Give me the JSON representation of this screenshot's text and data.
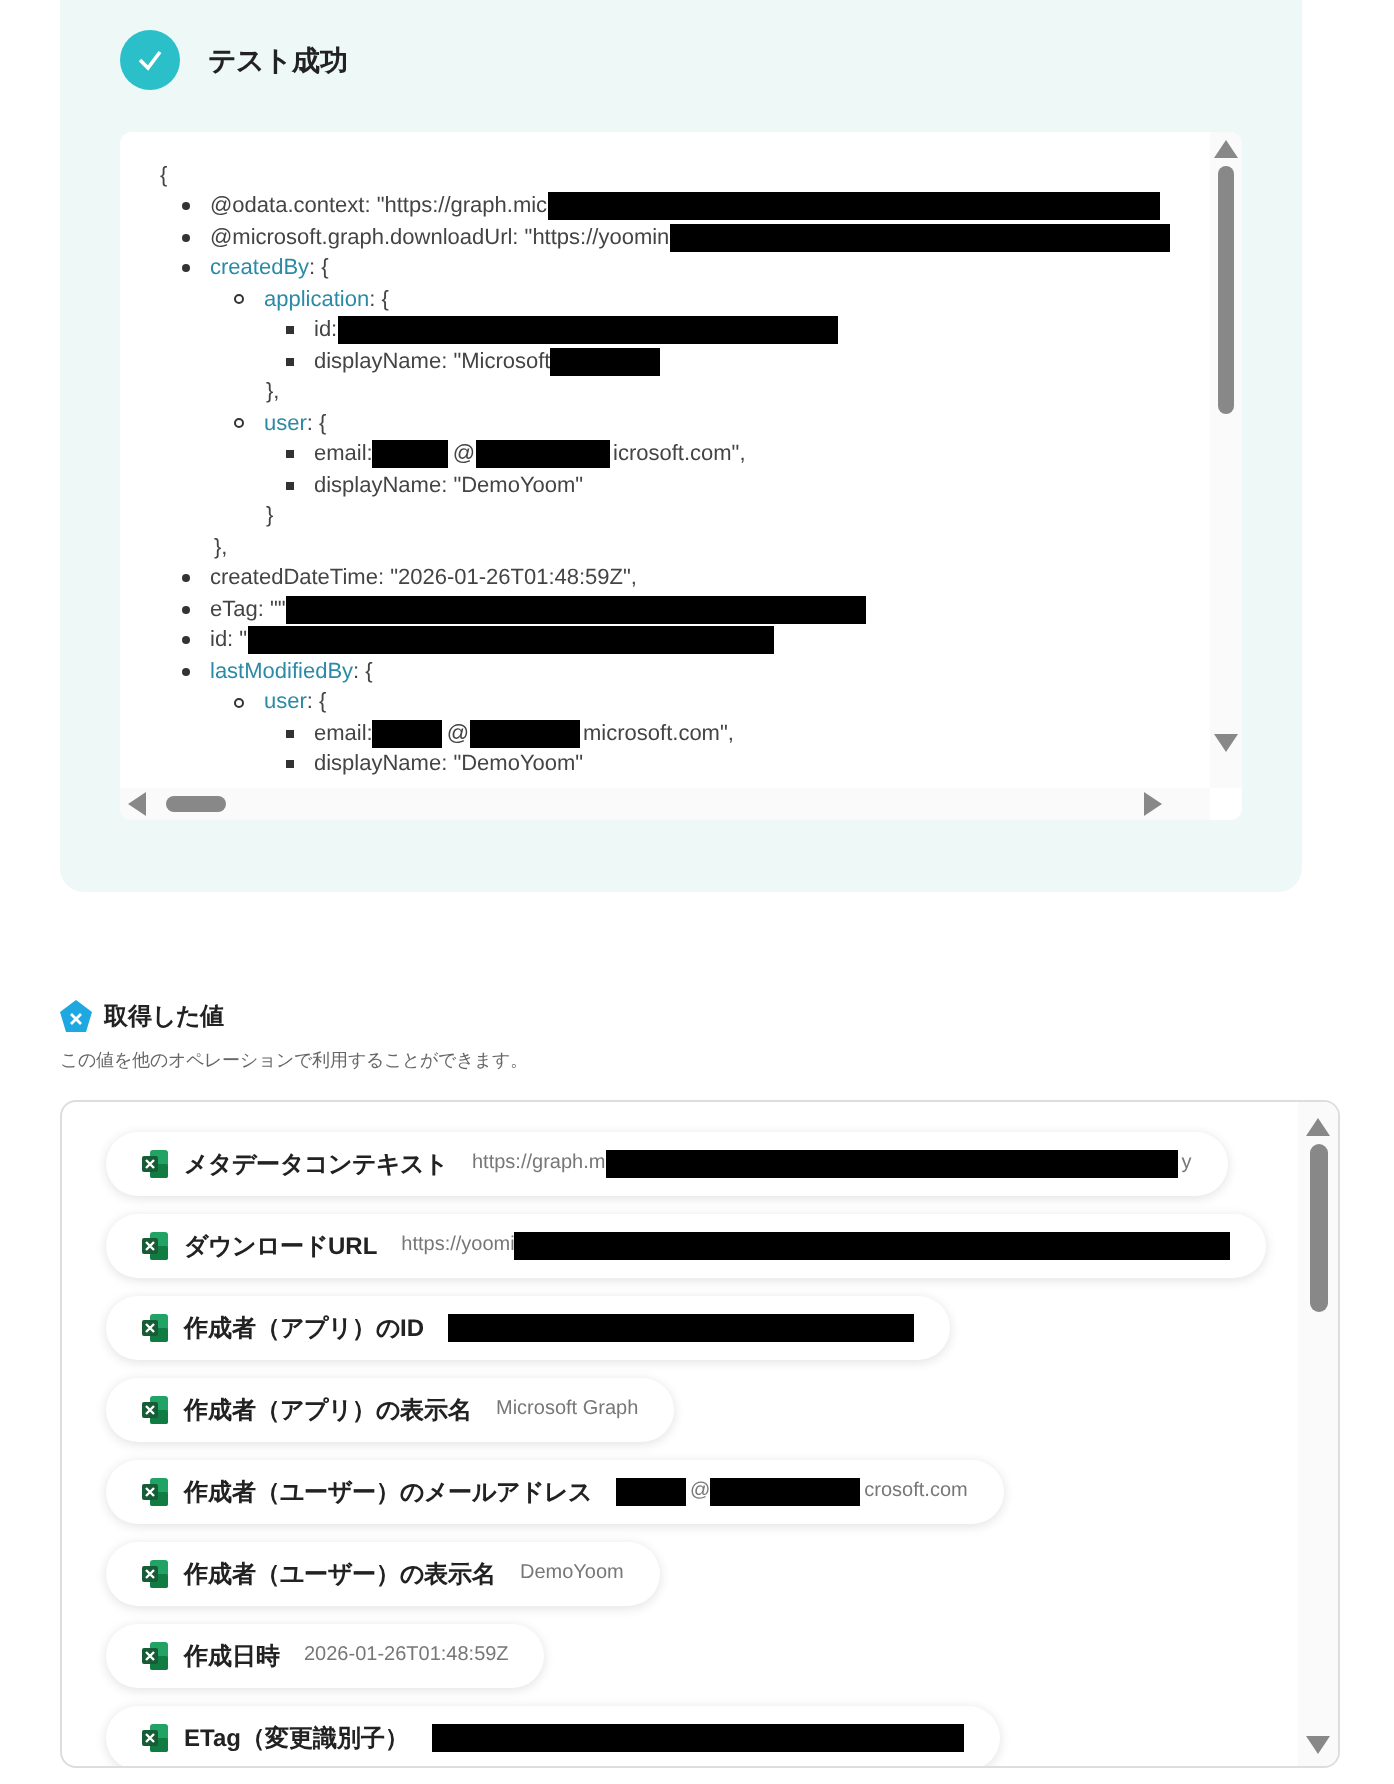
{
  "test_result": {
    "title": "テスト成功",
    "code_view": {
      "open": "{",
      "items": [
        {
          "kind": "value",
          "parts": [
            {
              "kind": "text",
              "text": "@odata.context: \"https://graph.mic"
            },
            {
              "kind": "redacted"
            }
          ]
        },
        {
          "kind": "value",
          "parts": [
            {
              "kind": "text",
              "text": "@microsoft.graph.downloadUrl: \"https://yoomin"
            },
            {
              "kind": "redacted"
            }
          ]
        },
        {
          "kind": "object",
          "key": "createdBy",
          "open": ": {",
          "close": "},",
          "children": [
            {
              "kind": "object",
              "key": "application",
              "open": ": {",
              "close": "},",
              "children": [
                {
                  "kind": "value",
                  "parts": [
                    {
                      "kind": "text",
                      "text": "id: "
                    },
                    {
                      "kind": "redacted"
                    }
                  ]
                },
                {
                  "kind": "value",
                  "parts": [
                    {
                      "kind": "text",
                      "text": "displayName: \"Microsoft"
                    },
                    {
                      "kind": "redacted"
                    }
                  ]
                }
              ]
            },
            {
              "kind": "object",
              "key": "user",
              "open": ": {",
              "close": "}",
              "children": [
                {
                  "kind": "value",
                  "parts": [
                    {
                      "kind": "text",
                      "text": "email:"
                    },
                    {
                      "kind": "redacted"
                    },
                    {
                      "kind": "text",
                      "text": "@"
                    },
                    {
                      "kind": "redacted"
                    },
                    {
                      "kind": "text",
                      "text": "icrosoft.com\","
                    }
                  ]
                },
                {
                  "kind": "value",
                  "parts": [
                    {
                      "kind": "text",
                      "text": "displayName: \"DemoYoom\""
                    }
                  ]
                }
              ]
            }
          ]
        },
        {
          "kind": "value",
          "parts": [
            {
              "kind": "text",
              "text": "createdDateTime: \"2026-01-26T01:48:59Z\","
            }
          ]
        },
        {
          "kind": "value",
          "parts": [
            {
              "kind": "text",
              "text": "eTag: \"\""
            },
            {
              "kind": "redacted"
            }
          ]
        },
        {
          "kind": "value",
          "parts": [
            {
              "kind": "text",
              "text": "id: \""
            },
            {
              "kind": "redacted"
            }
          ]
        },
        {
          "kind": "object",
          "key": "lastModifiedBy",
          "open": ": {",
          "children": [
            {
              "kind": "object",
              "key": "user",
              "open": ": {",
              "children": [
                {
                  "kind": "value",
                  "parts": [
                    {
                      "kind": "text",
                      "text": "email:"
                    },
                    {
                      "kind": "redacted"
                    },
                    {
                      "kind": "text",
                      "text": "@"
                    },
                    {
                      "kind": "redacted"
                    },
                    {
                      "kind": "text",
                      "text": "microsoft.com\","
                    }
                  ]
                },
                {
                  "kind": "value",
                  "parts": [
                    {
                      "kind": "text",
                      "text": "displayName: \"DemoYoom\""
                    }
                  ]
                }
              ]
            }
          ]
        }
      ]
    }
  },
  "obtained_values": {
    "title": "取得した値",
    "description": "この値を他のオペレーションで利用することができます。",
    "items": [
      {
        "label": "メタデータコンテキスト",
        "parts": [
          {
            "kind": "text",
            "text": "https://graph.m"
          },
          {
            "kind": "redacted"
          },
          {
            "kind": "text",
            "text": "y"
          }
        ]
      },
      {
        "label": "ダウンロードURL",
        "parts": [
          {
            "kind": "text",
            "text": "https://yoomi"
          },
          {
            "kind": "redacted"
          }
        ]
      },
      {
        "label": "作成者（アプリ）のID",
        "parts": [
          {
            "kind": "redacted"
          }
        ]
      },
      {
        "label": "作成者（アプリ）の表示名",
        "parts": [
          {
            "kind": "text",
            "text": "Microsoft Graph"
          }
        ]
      },
      {
        "label": "作成者（ユーザー）のメールアドレス",
        "parts": [
          {
            "kind": "redacted"
          },
          {
            "kind": "text",
            "text": "@"
          },
          {
            "kind": "redacted"
          },
          {
            "kind": "text",
            "text": "crosoft.com"
          }
        ]
      },
      {
        "label": "作成者（ユーザー）の表示名",
        "parts": [
          {
            "kind": "text",
            "text": "DemoYoom"
          }
        ]
      },
      {
        "label": "作成日時",
        "parts": [
          {
            "kind": "text",
            "text": "2026-01-26T01:48:59Z"
          }
        ]
      },
      {
        "label": "ETag（変更識別子）",
        "parts": [
          {
            "kind": "redacted"
          }
        ]
      }
    ]
  }
}
